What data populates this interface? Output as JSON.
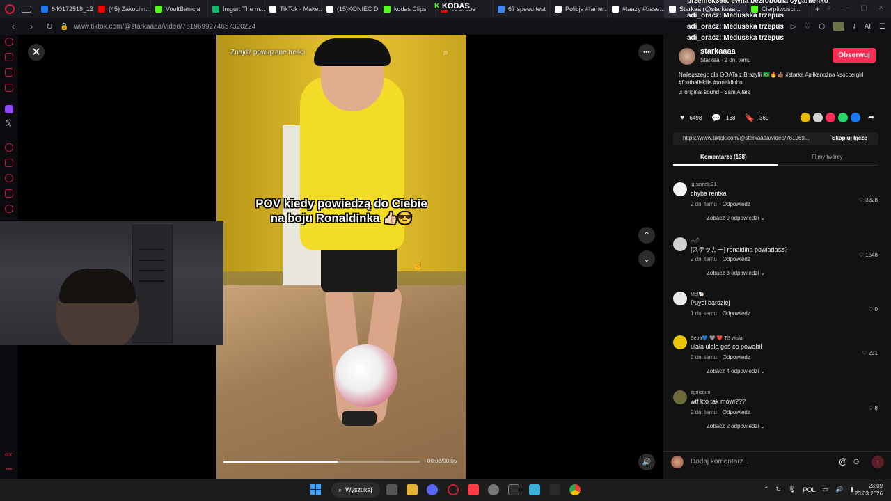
{
  "browser": {
    "tabs": [
      {
        "label": "640172519_13...",
        "color": "#1877f2"
      },
      {
        "label": "(45) Zakochn...",
        "color": "#ff0000"
      },
      {
        "label": "VooltBanicja",
        "color": "#53fc18"
      },
      {
        "label": "Imgur: The m...",
        "color": "#1bb76e"
      },
      {
        "label": "TikTok - Make...",
        "color": "#ffffff"
      },
      {
        "label": "(15)KONIEC D...",
        "color": "#ffffff"
      },
      {
        "label": "kodas Clips",
        "color": "#53fc18"
      },
      {
        "label": "YouTube",
        "color": "#ff0000"
      },
      {
        "label": "67 speed test",
        "color": "#4285f4"
      },
      {
        "label": "Policja #fame...",
        "color": "#ffffff"
      },
      {
        "label": "#taazy #base...",
        "color": "#ffffff"
      },
      {
        "label": "Starkaa (@starkaaa...",
        "color": "#ffffff",
        "active": true
      },
      {
        "label": "Cierpliwości...",
        "color": "#53fc18"
      }
    ],
    "kodas_logo": "KODAS",
    "new_tab": "+",
    "url": "www.tiktok.com/@starkaaaa/video/7619699274657320224",
    "ai_label": "AI"
  },
  "chat_overlay": [
    {
      "user": "przemek395",
      "text": ": ewha bezrobotna cyganienko"
    },
    {
      "user": "adi_oracz",
      "text": ": Medusska trzepus"
    },
    {
      "user": "adi_oracz",
      "text": ": Medusska trzepus"
    },
    {
      "user": "adi_oracz",
      "text": ": Medusska trzepus"
    }
  ],
  "video": {
    "related_label": "Znajdź powiązane treści",
    "caption_line1": "POV kiedy powiedzą do Ciebie",
    "caption_line2": "na boju Ronaldinka 👍🏻😎",
    "time": "00:03/00:05",
    "progress": 0.58,
    "close_glyph": "✕",
    "more_glyph": "•••",
    "up_glyph": "⌃",
    "down_glyph": "⌄",
    "volume_glyph": "🔊"
  },
  "post": {
    "username": "starkaaaa",
    "subline": "Starkaa · 2 dn. temu",
    "follow_label": "Obserwuj",
    "description": "Najlepszego dla GOATa z Brazylii 🇧🇷🔥👍🏽 #starka #piłkanożna #soccergirl #footballskills #ronaldinho",
    "sound": "original sound - Sam Allais",
    "likes": "6498",
    "comments": "138",
    "saves": "360",
    "share_colors": [
      "#e6b800",
      "#d0d0d0",
      "#fe2c55",
      "#25d366",
      "#1877f2"
    ],
    "link": "https://www.tiktok.com/@starkaaaa/video/761969...",
    "copy_label": "Skopiuj łącze",
    "tab_comments": "Komentarze (138)",
    "tab_videos": "Filmy twórcy"
  },
  "comments": [
    {
      "user": "ig.szmek.21",
      "text": "chyba rentka",
      "time": "2 dn. temu",
      "reply": "Odpowiedz",
      "likes": "3328",
      "more": "Zobacz 9 odpowiedzi",
      "avatar": "#f2f2f2"
    },
    {
      "user": "ₐₗ🌶",
      "text": "[ステッカー] ronaldiha powiadasz?",
      "time": "2 dn. temu",
      "reply": "Odpowiedz",
      "likes": "1548",
      "more": "Zobacz 3 odpowiedzi",
      "avatar": "#cfcfcf"
    },
    {
      "user": "Mel🐚",
      "text": "Puyol bardziej",
      "time": "1 dn. temu",
      "reply": "Odpowiedz",
      "likes": "0",
      "more": "",
      "avatar": "#e8e8e8"
    },
    {
      "user": "Seba💙 🩶 ❤️ TS wisła",
      "text": "ulala ulala goś co powabił",
      "time": "2 dn. temu",
      "reply": "Odpowiedz",
      "likes": "231",
      "more": "Zobacz 4 odpowiedzi",
      "avatar": "#e6c400"
    },
    {
      "user": "zgmcqun",
      "text": "wtf kto tak mówi???",
      "time": "2 dn. temu",
      "reply": "Odpowiedz",
      "likes": "8",
      "more": "Zobacz 2 odpowiedzi",
      "avatar": "#6b6b3a"
    }
  ],
  "composer": {
    "placeholder": "Dodaj komentarz...",
    "at": "@",
    "emoji": "☺",
    "send": "↑"
  },
  "taskbar": {
    "search_label": "Wyszukaj",
    "lang": "POL",
    "time": "23:09",
    "date": "23.03.2026"
  }
}
